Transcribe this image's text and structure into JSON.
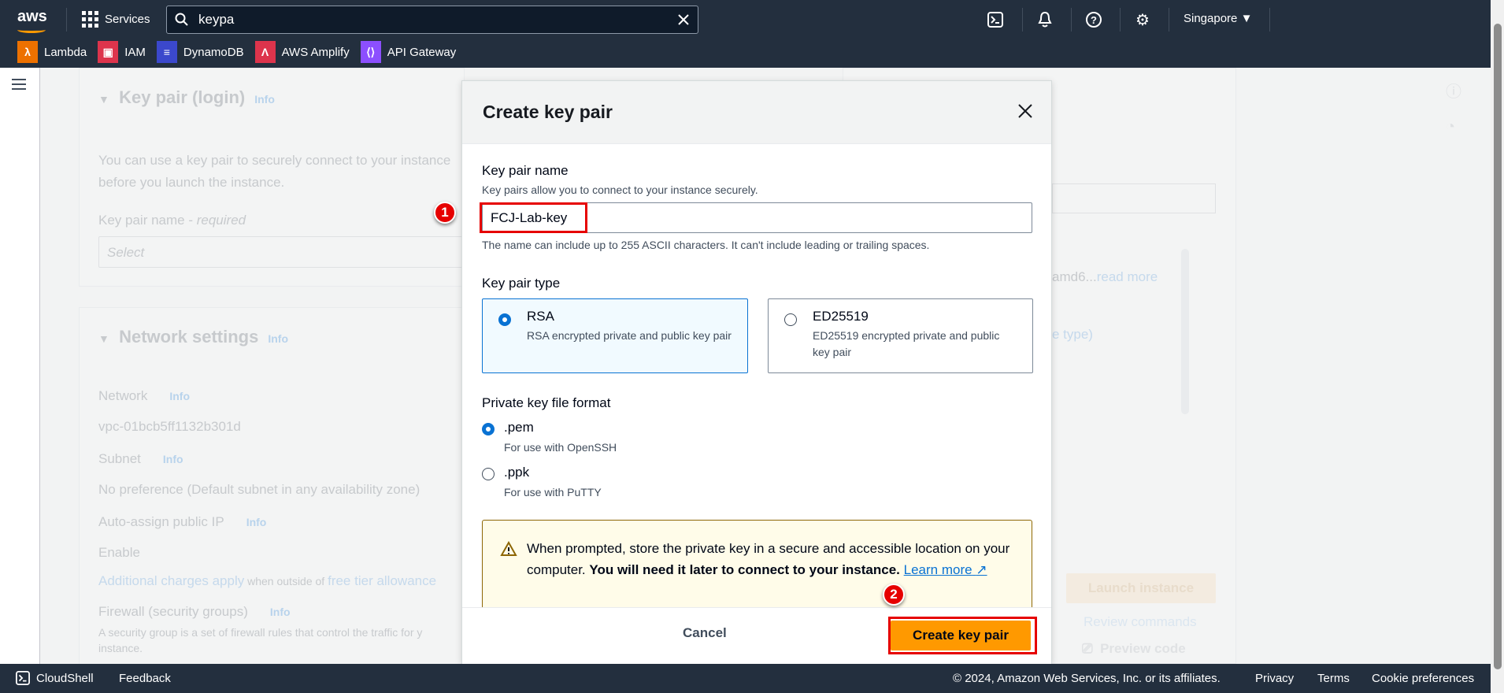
{
  "topnav": {
    "logo": "aws",
    "services_label": "Services",
    "search_value": "keypa",
    "region": "Singapore",
    "icons": [
      "cloudshell-icon",
      "bell-icon",
      "help-icon",
      "gear-icon"
    ],
    "shortcuts": [
      {
        "label": "Lambda",
        "color": "#ed7100",
        "icon": "λ"
      },
      {
        "label": "IAM",
        "color": "#dd344c",
        "icon": "▣"
      },
      {
        "label": "DynamoDB",
        "color": "#3b48cc",
        "icon": "≡"
      },
      {
        "label": "AWS Amplify",
        "color": "#dd344c",
        "icon": "Λ"
      },
      {
        "label": "API Gateway",
        "color": "#8c4fff",
        "icon": "⟨⟩"
      }
    ]
  },
  "background": {
    "keypair_section": {
      "title": "Key pair (login)",
      "info": "Info",
      "description_1": "You can use a key pair to securely connect to your instance",
      "description_2": "before you launch the instance.",
      "field_label": "Key pair name - ",
      "field_required": "required",
      "select_placeholder": "Select"
    },
    "network_section": {
      "title": "Network settings",
      "info": "Info",
      "network_label": "Network",
      "network_value": "vpc-01bcb5ff1132b301d",
      "subnet_label": "Subnet",
      "subnet_value": "No preference (Default subnet in any availability zone)",
      "public_ip_label": "Auto-assign public IP",
      "public_ip_value": "Enable",
      "charges_link": "Additional charges apply",
      "charges_mid": " when outside of ",
      "charges_link2": "free tier allowance",
      "firewall_label": "Firewall (security groups)",
      "firewall_desc": "A security group is a set of firewall rules that control the traffic for y",
      "firewall_desc2": "instance."
    },
    "summary": {
      "read_more_prefix": "amd6...",
      "read_more": "read more",
      "type_fragment": "e type)",
      "launch_button": "Launch instance",
      "review_commands": "Review commands",
      "preview_code": "Preview code"
    }
  },
  "modal": {
    "title": "Create key pair",
    "name_label": "Key pair name",
    "name_description": "Key pairs allow you to connect to your instance securely.",
    "name_value": "FCJ-Lab-key",
    "name_constraint": "The name can include up to 255 ASCII characters. It can't include leading or trailing spaces.",
    "type_label": "Key pair type",
    "types": [
      {
        "label": "RSA",
        "description": "RSA encrypted private and public key pair",
        "selected": true
      },
      {
        "label": "ED25519",
        "description": "ED25519 encrypted private and public key pair",
        "selected": false
      }
    ],
    "format_label": "Private key file format",
    "formats": [
      {
        "label": ".pem",
        "description": "For use with OpenSSH",
        "selected": true
      },
      {
        "label": ".ppk",
        "description": "For use with PuTTY",
        "selected": false
      }
    ],
    "alert_text": "When prompted, store the private key in a secure and accessible location on your computer. ",
    "alert_bold": "You will need it later to connect to your instance.",
    "alert_link": "Learn more",
    "cancel_label": "Cancel",
    "create_label": "Create key pair"
  },
  "annotations": {
    "step1": "1",
    "step2": "2",
    "highlight_color": "#e60000"
  },
  "footer": {
    "cloudshell": "CloudShell",
    "feedback": "Feedback",
    "copyright": "© 2024, Amazon Web Services, Inc. or its affiliates.",
    "privacy": "Privacy",
    "terms": "Terms",
    "cookies": "Cookie preferences"
  }
}
